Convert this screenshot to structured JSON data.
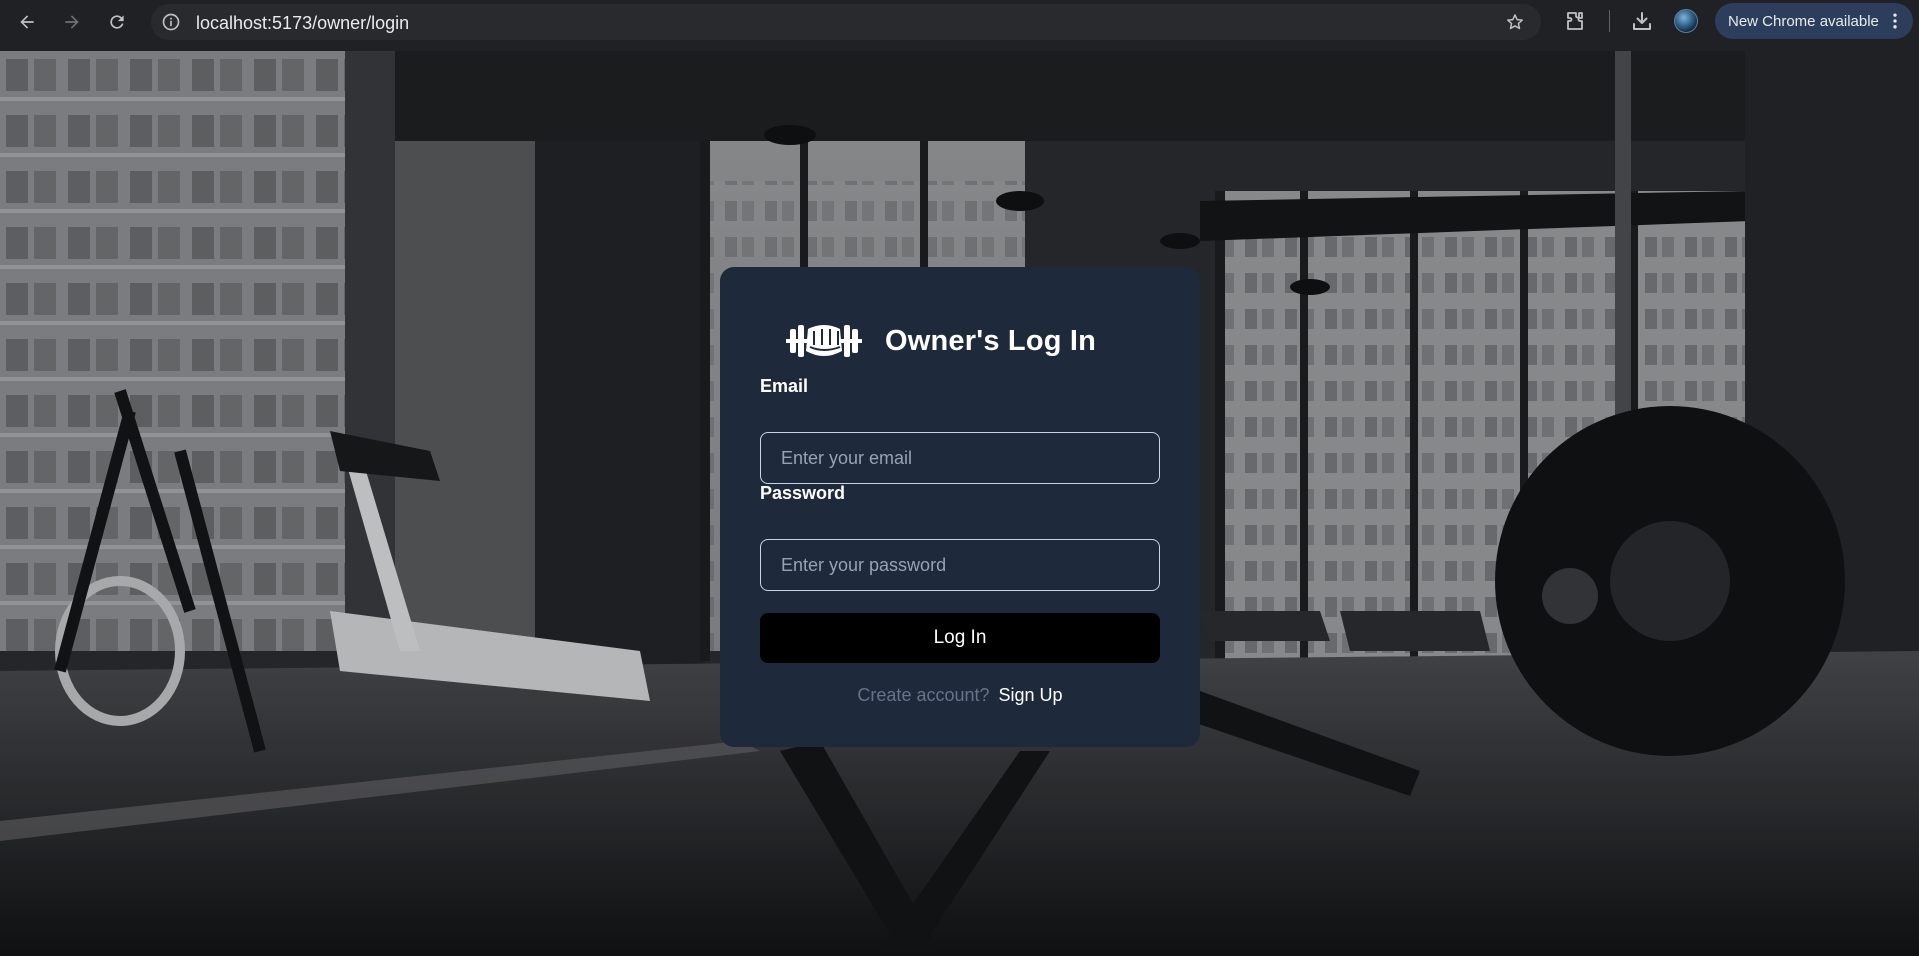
{
  "browser": {
    "url": "localhost:5173/owner/login",
    "update_label": "New Chrome available"
  },
  "login": {
    "title": "Owner's Log In",
    "email_label": "Email",
    "email_placeholder": "Enter your email",
    "email_value": "",
    "password_label": "Password",
    "password_placeholder": "Enter your password",
    "password_value": "",
    "submit_label": "Log In",
    "signup_prompt": "Create account?",
    "signup_link": "Sign Up"
  },
  "icons": {
    "back": "arrow-left-icon",
    "forward": "arrow-right-icon",
    "reload": "reload-icon",
    "site_info": "info-icon",
    "bookmark": "star-icon",
    "extensions": "puzzle-icon",
    "downloads": "download-icon",
    "menu": "kebab-menu-icon",
    "logo": "fist-dumbbell-logo"
  },
  "colors": {
    "chrome_bg": "#202124",
    "card_bg": "#1e293b",
    "button_bg": "#000000",
    "input_border": "#cbd5e1",
    "placeholder": "#94a3b8",
    "signup_prompt": "#64748b"
  }
}
